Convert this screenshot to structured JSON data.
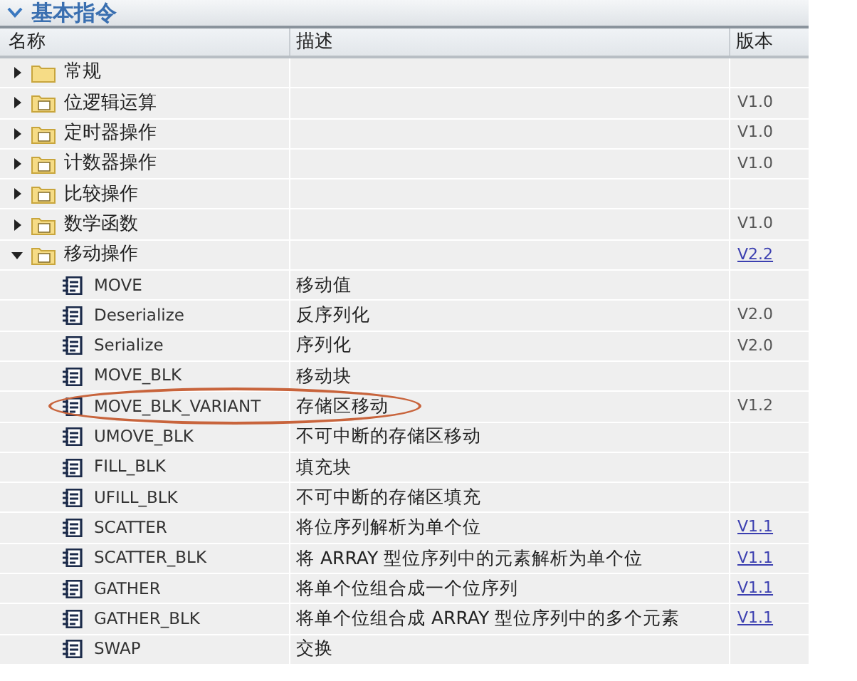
{
  "panel": {
    "title": "基本指令",
    "expanded": true
  },
  "columns": [
    "名称",
    "描述",
    "版本"
  ],
  "tree": [
    {
      "name": "常规",
      "expanded": false
    },
    {
      "name": "位逻辑运算",
      "expanded": false,
      "version": "V1.0",
      "version_link": false
    },
    {
      "name": "定时器操作",
      "expanded": false,
      "version": "V1.0",
      "version_link": false
    },
    {
      "name": "计数器操作",
      "expanded": false,
      "version": "V1.0",
      "version_link": false
    },
    {
      "name": "比较操作",
      "expanded": false
    },
    {
      "name": "数学函数",
      "expanded": false,
      "version": "V1.0",
      "version_link": false
    },
    {
      "name": "移动操作",
      "expanded": true,
      "version": "V2.2",
      "version_link": true,
      "children": [
        {
          "name": "MOVE",
          "description": "移动值",
          "highlighted": false
        },
        {
          "name": "Deserialize",
          "description": "反序列化",
          "version": "V2.0",
          "version_link": false,
          "highlighted": false
        },
        {
          "name": "Serialize",
          "description": "序列化",
          "version": "V2.0",
          "version_link": false,
          "highlighted": false
        },
        {
          "name": "MOVE_BLK",
          "description": "移动块",
          "highlighted": false
        },
        {
          "name": "MOVE_BLK_VARIANT",
          "description": "存储区移动",
          "version": "V1.2",
          "version_link": false,
          "highlighted": true
        },
        {
          "name": "UMOVE_BLK",
          "description": "不可中断的存储区移动",
          "highlighted": false
        },
        {
          "name": "FILL_BLK",
          "description": "填充块",
          "highlighted": false
        },
        {
          "name": "UFILL_BLK",
          "description": "不可中断的存储区填充",
          "highlighted": false
        },
        {
          "name": "SCATTER",
          "description": "将位序列解析为单个位",
          "version": "V1.1",
          "version_link": true,
          "highlighted": false
        },
        {
          "name": "SCATTER_BLK",
          "description": "将 ARRAY 型位序列中的元素解析为单个位",
          "version": "V1.1",
          "version_link": true,
          "highlighted": false
        },
        {
          "name": "GATHER",
          "description": "将单个位组合成一个位序列",
          "version": "V1.1",
          "version_link": true,
          "highlighted": false
        },
        {
          "name": "GATHER_BLK",
          "description": "将单个位组合成 ARRAY 型位序列中的多个元素",
          "version": "V1.1",
          "version_link": true,
          "highlighted": false
        },
        {
          "name": "SWAP",
          "description": "交换",
          "highlighted": false
        }
      ]
    }
  ]
}
